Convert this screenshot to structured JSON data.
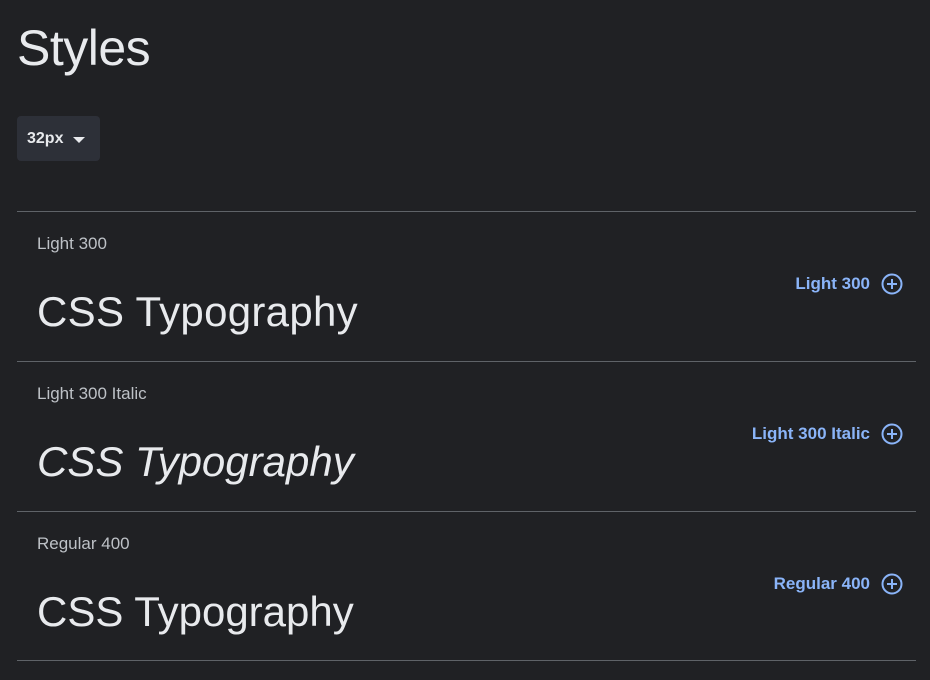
{
  "header": {
    "title": "Styles"
  },
  "size_select": {
    "value": "32px"
  },
  "styles": [
    {
      "name": "Light 300",
      "specimen": "CSS Typography",
      "button_label": "Light 300",
      "variant": "light"
    },
    {
      "name": "Light 300 Italic",
      "specimen": "CSS Typography",
      "button_label": "Light 300 Italic",
      "variant": "italic"
    },
    {
      "name": "Regular 400",
      "specimen": "CSS Typography",
      "button_label": "Regular 400",
      "variant": "regular"
    }
  ],
  "icons": {
    "add": "add-circle-icon",
    "dropdown": "caret-down-icon"
  },
  "colors": {
    "background": "#202124",
    "accent": "#8ab4f8",
    "divider": "#5f6368",
    "select_bg": "#2d3038"
  }
}
